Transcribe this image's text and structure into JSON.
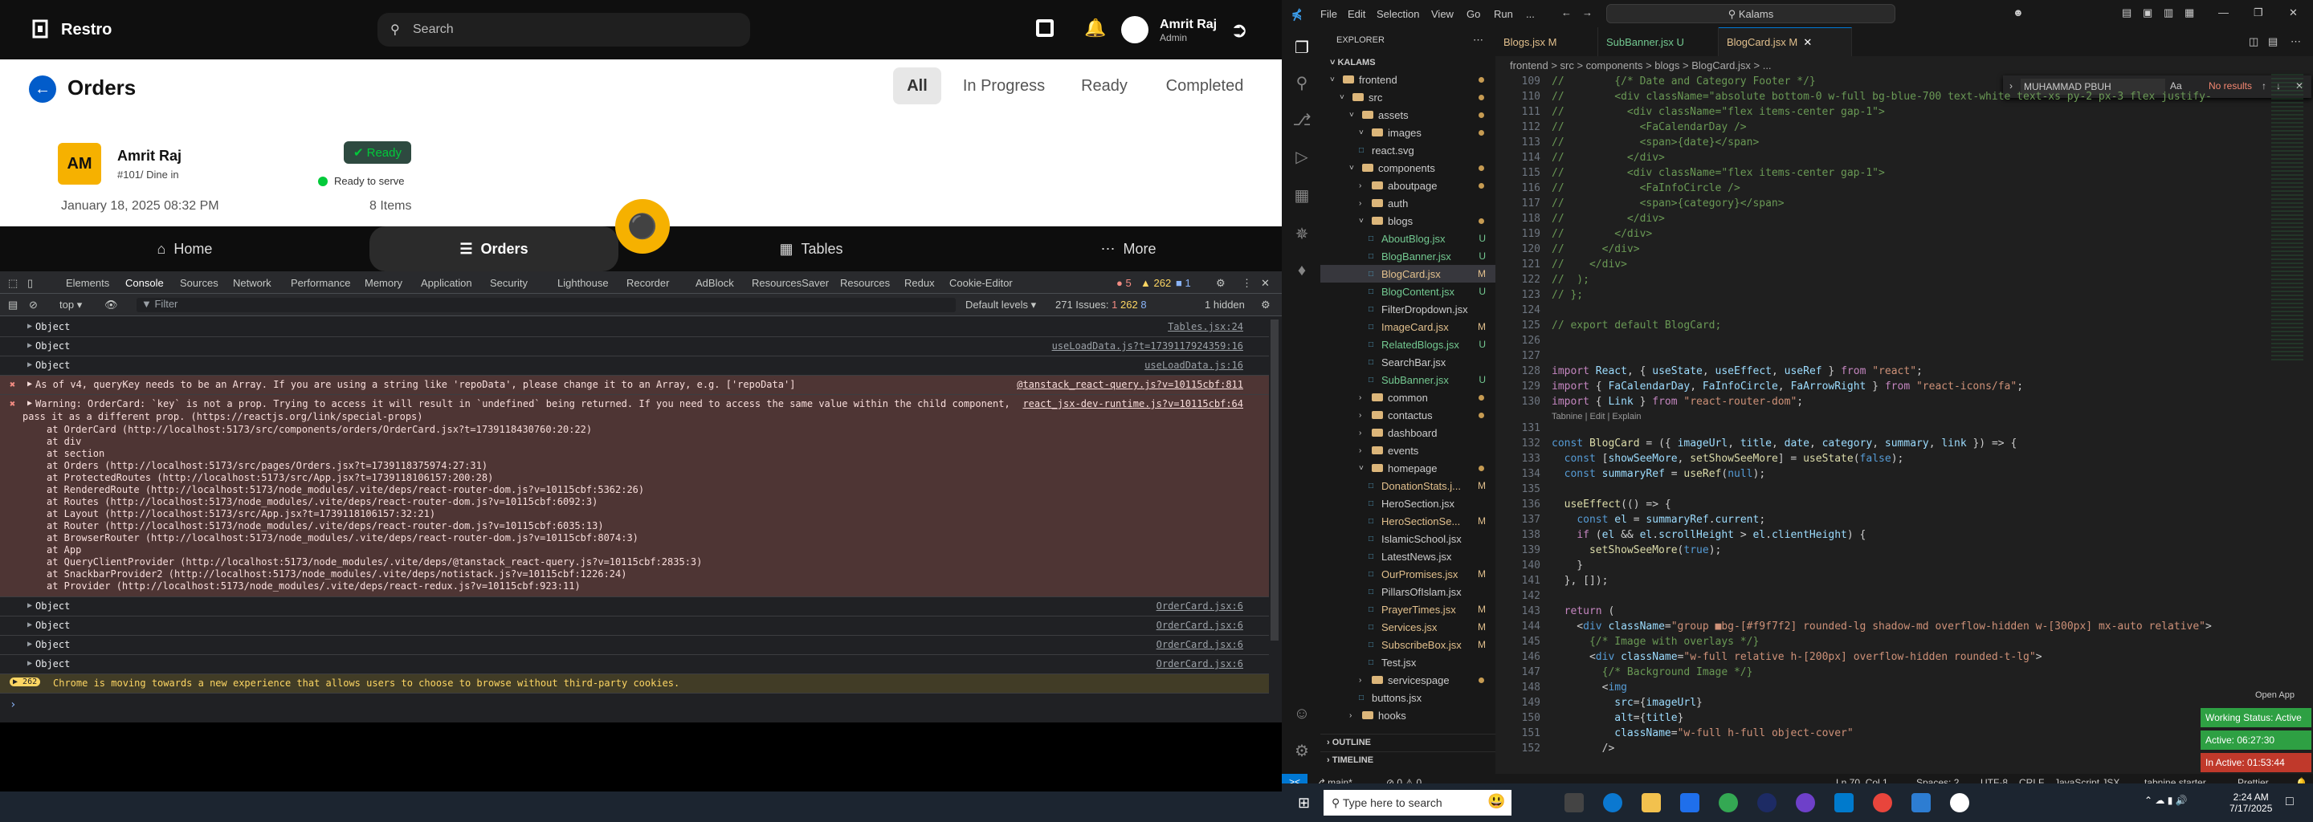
{
  "app": {
    "brand": "Restro",
    "search_placeholder": "Search",
    "user_name": "Amrit Raj",
    "user_role": "Admin",
    "page_title": "Orders",
    "filters": [
      "All",
      "In Progress",
      "Ready",
      "Completed"
    ],
    "order": {
      "initials": "AM",
      "name": "Amrit Raj",
      "table": "#101/ Dine in",
      "badge": "Ready",
      "status": "Ready to serve",
      "date": "January 18, 2025 08:32 PM",
      "items": "8 Items"
    },
    "nav": [
      "Home",
      "Orders",
      "Tables",
      "More"
    ],
    "colors": {
      "accent": "#f6b100",
      "ready": "#02ca3a",
      "brand_bg": "#1f1f1f",
      "blue": "#1a73e8"
    }
  },
  "devtools": {
    "tabs": [
      "Elements",
      "Console",
      "Sources",
      "Network",
      "Performance",
      "Memory",
      "Application",
      "Security",
      "Lighthouse",
      "Recorder",
      "AdBlock",
      "ResourcesSaver",
      "Resources",
      "Redux",
      "Cookie-Editor"
    ],
    "error_count": "5",
    "warn_count": "262",
    "info_count": "1",
    "context": "top",
    "filter_placeholder": "Filter",
    "levels": "Default levels",
    "issues": "271 Issues:",
    "issue_err": "1",
    "issue_warn": "262",
    "issue_info": "8",
    "hidden": "1 hidden",
    "logs": [
      {
        "text": "Object",
        "src": "Tables.jsx:24"
      },
      {
        "text": "Object",
        "src": "useLoadData.js?t=1739117924359:16"
      },
      {
        "text": "Object",
        "src": "useLoadData.js:16"
      }
    ],
    "error1": {
      "text": "As of v4, queryKey needs to be an Array. If you are using a string like 'repoData', please change it to an Array, e.g. ['repoData']",
      "src": "@tanstack_react-query.js?v=10115cbf:811"
    },
    "error2": {
      "text": "Warning: OrderCard: `key` is not a prop. Trying to access it will result in `undefined` being returned. If you need to access the same value within the child component, you should",
      "text2": "pass it as a different prop. (https://reactjs.org/link/special-props)",
      "src": "react_jsx-dev-runtime.js?v=10115cbf:64"
    },
    "stack": [
      "at OrderCard (http://localhost:5173/src/components/orders/OrderCard.jsx?t=1739118430760:20:22)",
      "at div",
      "at section",
      "at Orders (http://localhost:5173/src/pages/Orders.jsx?t=1739118375974:27:31)",
      "at ProtectedRoutes (http://localhost:5173/src/App.jsx?t=1739118106157:200:28)",
      "at RenderedRoute (http://localhost:5173/node_modules/.vite/deps/react-router-dom.js?v=10115cbf:5362:26)",
      "at Routes (http://localhost:5173/node_modules/.vite/deps/react-router-dom.js?v=10115cbf:6092:3)",
      "at Layout (http://localhost:5173/src/App.jsx?t=1739118106157:32:21)",
      "at Router (http://localhost:5173/node_modules/.vite/deps/react-router-dom.js?v=10115cbf:6035:13)",
      "at BrowserRouter (http://localhost:5173/node_modules/.vite/deps/react-router-dom.js?v=10115cbf:8074:3)",
      "at App",
      "at QueryClientProvider (http://localhost:5173/node_modules/.vite/deps/@tanstack_react-query.js?v=10115cbf:2835:3)",
      "at SnackbarProvider2 (http://localhost:5173/node_modules/.vite/deps/notistack.js?v=10115cbf:1226:24)",
      "at Provider (http://localhost:5173/node_modules/.vite/deps/react-redux.js?v=10115cbf:923:11)"
    ],
    "logs2": [
      {
        "text": "Object",
        "src": "OrderCard.jsx:6"
      },
      {
        "text": "Object",
        "src": "OrderCard.jsx:6"
      },
      {
        "text": "Object",
        "src": "OrderCard.jsx:6"
      },
      {
        "text": "Object",
        "src": "OrderCard.jsx:6"
      }
    ],
    "chrome_msg_count": "262",
    "chrome_msg": "Chrome is moving towards a new experience that allows users to choose to browse without third-party cookies."
  },
  "vscode": {
    "menu": [
      "File",
      "Edit",
      "Selection",
      "View",
      "Go",
      "Run",
      "..."
    ],
    "search": "Kalams",
    "explorer_title": "EXPLORER",
    "root": "KALAMS",
    "tabs": [
      {
        "name": "Blogs.jsx",
        "st": "M"
      },
      {
        "name": "SubBanner.jsx",
        "st": "U"
      },
      {
        "name": "BlogCard.jsx",
        "st": "M"
      }
    ],
    "breadcrumb": "frontend > src > components > blogs > BlogCard.jsx > ...",
    "find_text": "MUHAMMAD PBUH",
    "find_result": "No results",
    "tree": [
      {
        "label": "frontend",
        "depth": 1,
        "folder": true,
        "open": true,
        "st": "dot"
      },
      {
        "label": "src",
        "depth": 2,
        "folder": true,
        "open": true,
        "st": "dot"
      },
      {
        "label": "assets",
        "depth": 3,
        "folder": true,
        "open": true,
        "st": "dot"
      },
      {
        "label": "images",
        "depth": 4,
        "folder": true,
        "open": true,
        "st": "dot"
      },
      {
        "label": "react.svg",
        "depth": 4,
        "folder": false,
        "st": ""
      },
      {
        "label": "components",
        "depth": 3,
        "folder": true,
        "open": true,
        "st": "dot"
      },
      {
        "label": "aboutpage",
        "depth": 4,
        "folder": true,
        "open": false,
        "st": "dot"
      },
      {
        "label": "auth",
        "depth": 4,
        "folder": true,
        "open": false,
        "st": ""
      },
      {
        "label": "blogs",
        "depth": 4,
        "folder": true,
        "open": true,
        "st": "dot"
      },
      {
        "label": "AboutBlog.jsx",
        "depth": 5,
        "folder": false,
        "st": "U"
      },
      {
        "label": "BlogBanner.jsx",
        "depth": 5,
        "folder": false,
        "st": "U"
      },
      {
        "label": "BlogCard.jsx",
        "depth": 5,
        "folder": false,
        "st": "M"
      },
      {
        "label": "BlogContent.jsx",
        "depth": 5,
        "folder": false,
        "st": "U"
      },
      {
        "label": "FilterDropdown.jsx",
        "depth": 5,
        "folder": false,
        "st": ""
      },
      {
        "label": "ImageCard.jsx",
        "depth": 5,
        "folder": false,
        "st": "M"
      },
      {
        "label": "RelatedBlogs.jsx",
        "depth": 5,
        "folder": false,
        "st": "U"
      },
      {
        "label": "SearchBar.jsx",
        "depth": 5,
        "folder": false,
        "st": ""
      },
      {
        "label": "SubBanner.jsx",
        "depth": 5,
        "folder": false,
        "st": "U"
      },
      {
        "label": "common",
        "depth": 4,
        "folder": true,
        "open": false,
        "st": "dot"
      },
      {
        "label": "contactus",
        "depth": 4,
        "folder": true,
        "open": false,
        "st": "dot"
      },
      {
        "label": "dashboard",
        "depth": 4,
        "folder": true,
        "open": false,
        "st": ""
      },
      {
        "label": "events",
        "depth": 4,
        "folder": true,
        "open": false,
        "st": ""
      },
      {
        "label": "homepage",
        "depth": 4,
        "folder": true,
        "open": true,
        "st": "dot"
      },
      {
        "label": "DonationStats.j...",
        "depth": 5,
        "folder": false,
        "st": "M"
      },
      {
        "label": "HeroSection.jsx",
        "depth": 5,
        "folder": false,
        "st": ""
      },
      {
        "label": "HeroSectionSe...",
        "depth": 5,
        "folder": false,
        "st": "M"
      },
      {
        "label": "IslamicSchool.jsx",
        "depth": 5,
        "folder": false,
        "st": ""
      },
      {
        "label": "LatestNews.jsx",
        "depth": 5,
        "folder": false,
        "st": ""
      },
      {
        "label": "OurPromises.jsx",
        "depth": 5,
        "folder": false,
        "st": "M"
      },
      {
        "label": "PillarsOfIslam.jsx",
        "depth": 5,
        "folder": false,
        "st": ""
      },
      {
        "label": "PrayerTimes.jsx",
        "depth": 5,
        "folder": false,
        "st": "M"
      },
      {
        "label": "Services.jsx",
        "depth": 5,
        "folder": false,
        "st": "M"
      },
      {
        "label": "SubscribeBox.jsx",
        "depth": 5,
        "folder": false,
        "st": "M"
      },
      {
        "label": "Test.jsx",
        "depth": 5,
        "folder": false,
        "st": ""
      },
      {
        "label": "servicespage",
        "depth": 4,
        "folder": true,
        "open": false,
        "st": "dot"
      },
      {
        "label": "buttons.jsx",
        "depth": 4,
        "folder": false,
        "st": ""
      },
      {
        "label": "hooks",
        "depth": 3,
        "folder": true,
        "open": false,
        "st": ""
      }
    ],
    "outline": "OUTLINE",
    "timeline": "TIMELINE",
    "status": {
      "branch": "main*",
      "errors": "0 ⚠ 0",
      "pos": "Ln 70, Col 1",
      "spaces": "Spaces: 2",
      "enc": "UTF-8",
      "eol": "CRLF",
      "lang": "JavaScript JSX",
      "tabnine": "tabnine starter",
      "prettier": "Prettier"
    },
    "codelens": "Tabnine | Edit | Explain",
    "open_app": "Open App",
    "working": "Working Status: Active",
    "active": "Active: 06:27:30",
    "inactive": "In Active: 01:53:44"
  },
  "taskbar": {
    "search": "Type here to search",
    "time": "2:24 AM",
    "date": "7/17/2025"
  }
}
